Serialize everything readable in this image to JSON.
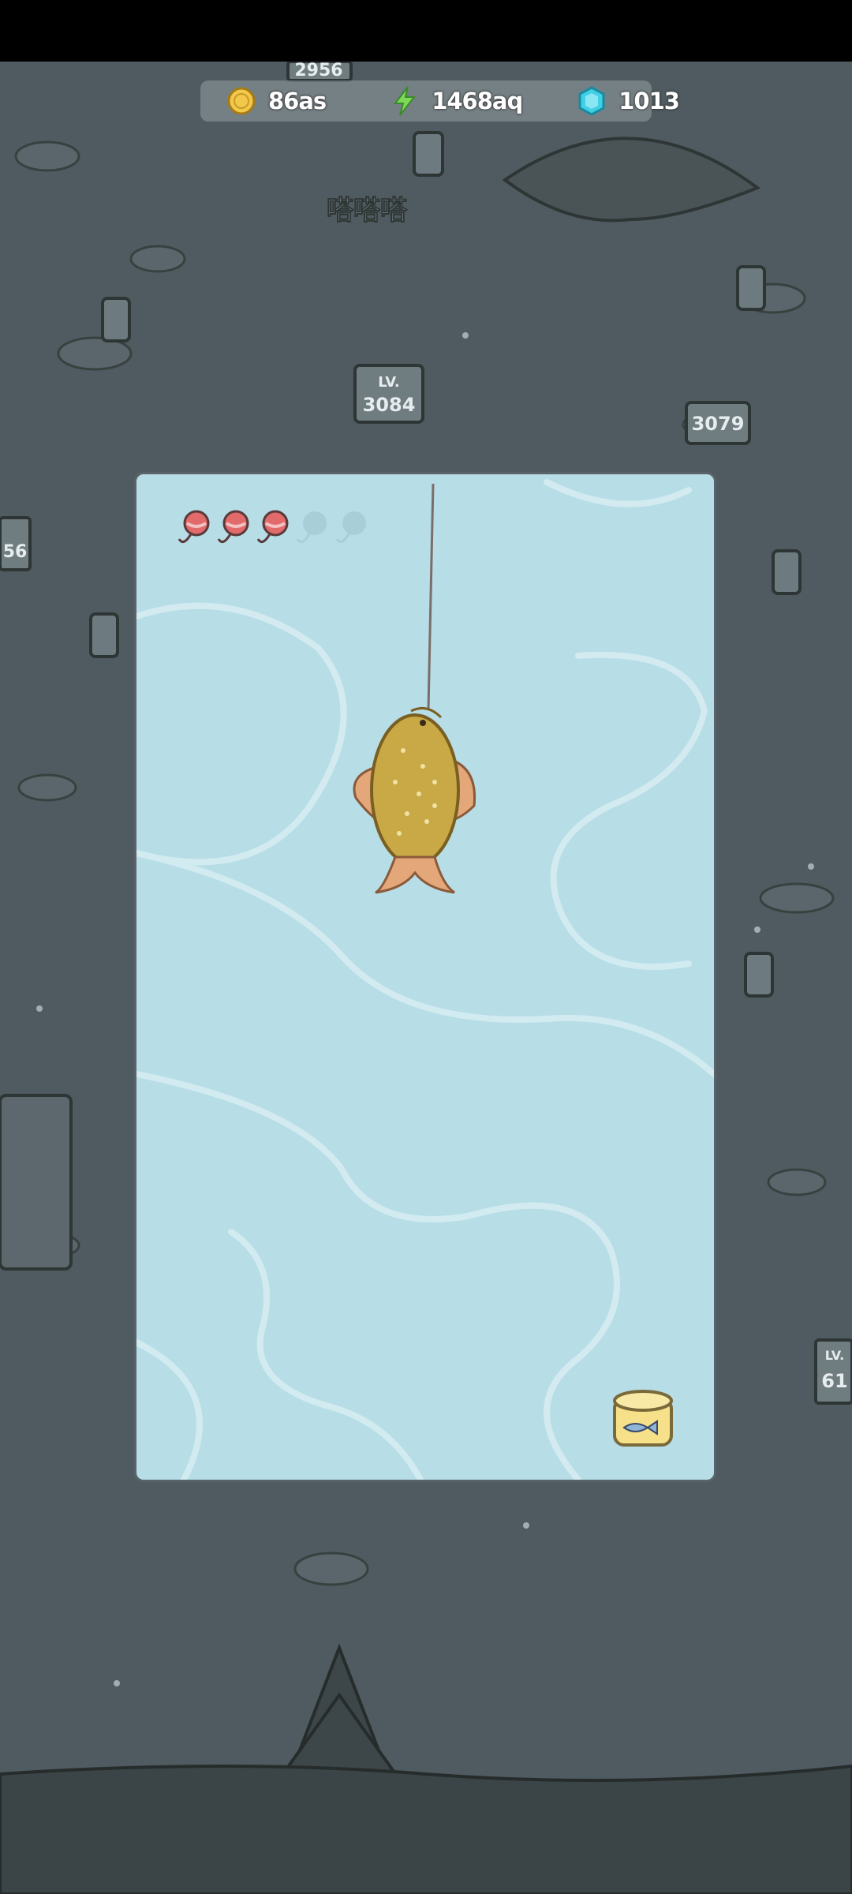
{
  "resources": {
    "coins": {
      "value": "86as",
      "icon": "gold-coin-icon",
      "color": "#f2c84b"
    },
    "energy": {
      "value": "1468aq",
      "icon": "lightning-icon",
      "color": "#7ed957"
    },
    "gems": {
      "value": "1013",
      "icon": "blue-gem-icon",
      "color": "#3fd0e6"
    }
  },
  "background_labels": {
    "top_sign": "2956",
    "left_sign": "56",
    "center_sign_level": "LV.",
    "center_sign": "3084",
    "right_sign": "3079",
    "bottom_right_sign_level": "LV.",
    "bottom_right_sign": "61",
    "sound_effect": "嗒嗒嗒"
  },
  "fishing": {
    "lures_total": 5,
    "lures_remaining": 3,
    "lure_color": "#e26a6a",
    "water_color": "#b7dde6",
    "fish_color": "#c9a945",
    "bait_icon": "bait-jar-icon"
  }
}
